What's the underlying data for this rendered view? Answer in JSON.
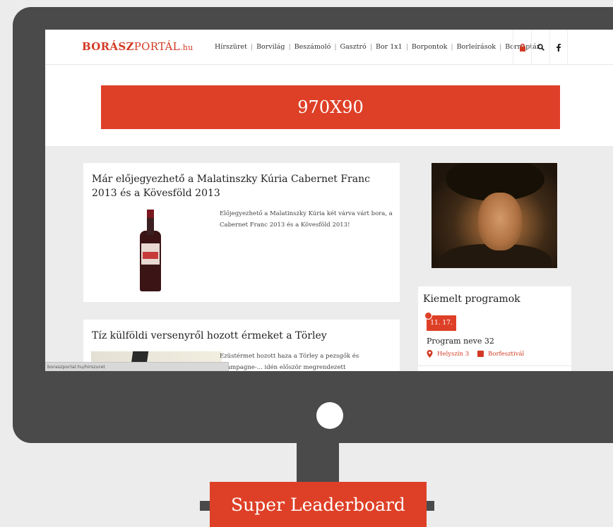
{
  "site": {
    "logo_bold": "BORÁSZ",
    "logo_rest": "PORTÁL",
    "logo_tld": ".hu",
    "nav": [
      "Hírszüret",
      "Borvilág",
      "Beszámoló",
      "Gasztró",
      "Bor 1x1",
      "Borpontok",
      "Borleírások",
      "Bornaptár"
    ],
    "icons": [
      "lock-icon",
      "search-icon",
      "facebook-icon"
    ]
  },
  "banner": {
    "label": "970X90"
  },
  "articles": [
    {
      "title": "Már előjegyezhető a Malatinszky Kúria Cabernet Franc 2013 és a Kövesföld 2013",
      "excerpt": "Előjegyezhető a Malatinszky Kúria két várva várt bora, a Cabernet Franc 2013 és a Kövesföld 2013!"
    },
    {
      "title": "Tíz külföldi versenyről hozott érmeket a Törley",
      "excerpt": "Ezüstérmet hozott haza a Törley a pezsgők és champagne-... idén először megrendezett világbajnokságáról, aranyat"
    }
  ],
  "events": {
    "title": "Kiemelt programok",
    "date": "11. 17.",
    "name": "Program neve 32",
    "location": "Helyszín 3",
    "category": "Borfesztivál"
  },
  "status_url": "boraszportal.hu/hirszuret",
  "ad_label": "Super Leaderboard",
  "colors": {
    "accent": "#de4027",
    "frame": "#4a4a4a",
    "background": "#ececec"
  }
}
